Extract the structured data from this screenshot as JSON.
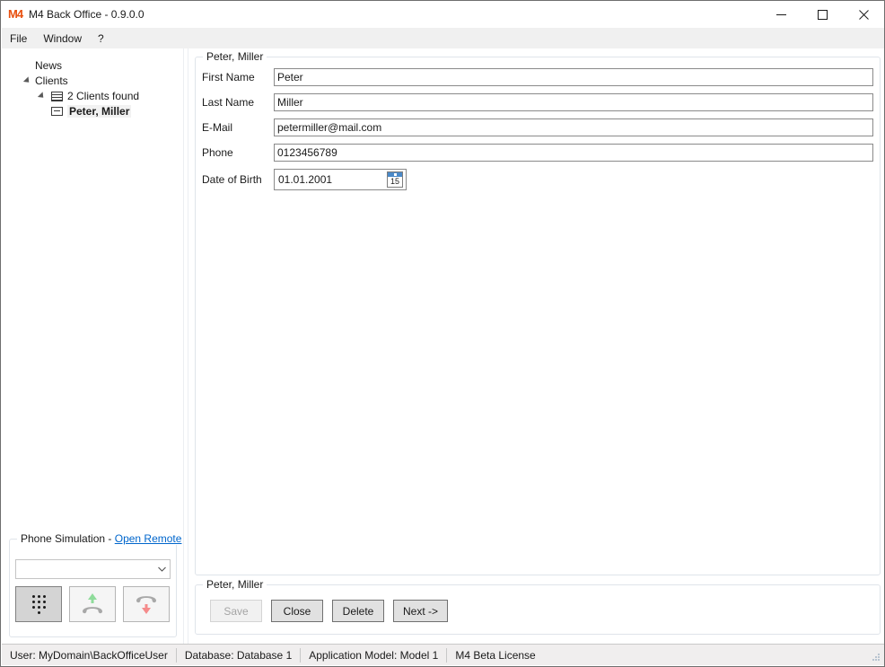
{
  "window": {
    "logo": "M4",
    "title": "M4 Back Office - 0.9.0.0",
    "minimize_icon": "minimize-icon",
    "maximize_icon": "maximize-icon",
    "close_icon": "close-icon"
  },
  "menubar": {
    "items": [
      {
        "label": "File"
      },
      {
        "label": "Window"
      },
      {
        "label": "?"
      }
    ]
  },
  "tree": {
    "items": [
      {
        "label": "News",
        "level": 1,
        "expander": false,
        "icon": null,
        "selected": false
      },
      {
        "label": "Clients",
        "level": 2,
        "expander": true,
        "icon": null,
        "selected": false
      },
      {
        "label": "2 Clients found",
        "level": 3,
        "expander": true,
        "icon": "list-icon",
        "selected": false
      },
      {
        "label": "Peter, Miller",
        "level": 4,
        "expander": false,
        "icon": "card-icon",
        "selected": true
      }
    ]
  },
  "phone_simulation": {
    "legend_prefix": "Phone Simulation - ",
    "link_label": "Open Remote",
    "combo": {
      "value": "",
      "placeholder": "",
      "arrow_icon": "chevron-down-icon"
    },
    "buttons": [
      {
        "name": "dialpad-button",
        "icon": "keypad-icon",
        "pressed": true
      },
      {
        "name": "answer-call-button",
        "icon": "phone-up-arrow-icon",
        "pressed": false
      },
      {
        "name": "hangup-call-button",
        "icon": "phone-down-arrow-icon",
        "pressed": false
      }
    ]
  },
  "detail": {
    "legend": "Peter, Miller",
    "fields": [
      {
        "label": "First Name",
        "value": "Peter",
        "name": "first-name"
      },
      {
        "label": "Last Name",
        "value": "Miller",
        "name": "last-name"
      },
      {
        "label": "E-Mail",
        "value": "petermiller@mail.com",
        "name": "email"
      },
      {
        "label": "Phone",
        "value": "0123456789",
        "name": "phone"
      }
    ],
    "date_of_birth": {
      "label": "Date of Birth",
      "value": "01.01.2001",
      "calendar_icon": "calendar-icon",
      "calendar_day": "15"
    }
  },
  "actions": {
    "legend": "Peter, Miller",
    "buttons": [
      {
        "label": "Save",
        "name": "save-button",
        "disabled": true
      },
      {
        "label": "Close",
        "name": "close-button",
        "disabled": false
      },
      {
        "label": "Delete",
        "name": "delete-button",
        "disabled": false
      },
      {
        "label": "Next ->",
        "name": "next-button",
        "disabled": false
      }
    ]
  },
  "statusbar": {
    "cells": [
      {
        "text": "User: MyDomain\\BackOfficeUser",
        "name": "status-user"
      },
      {
        "text": "Database: Database 1",
        "name": "status-database"
      },
      {
        "text": "Application Model: Model 1",
        "name": "status-application-model"
      },
      {
        "text": "M4 Beta License",
        "name": "status-license"
      }
    ]
  },
  "colors": {
    "logo": "#e8500f",
    "link": "#0066cc",
    "calendar_header": "#4a89c8",
    "answer_arrow": "#8fdc9b",
    "hangup_arrow": "#f58b8b",
    "handset": "#a8a8a8"
  }
}
